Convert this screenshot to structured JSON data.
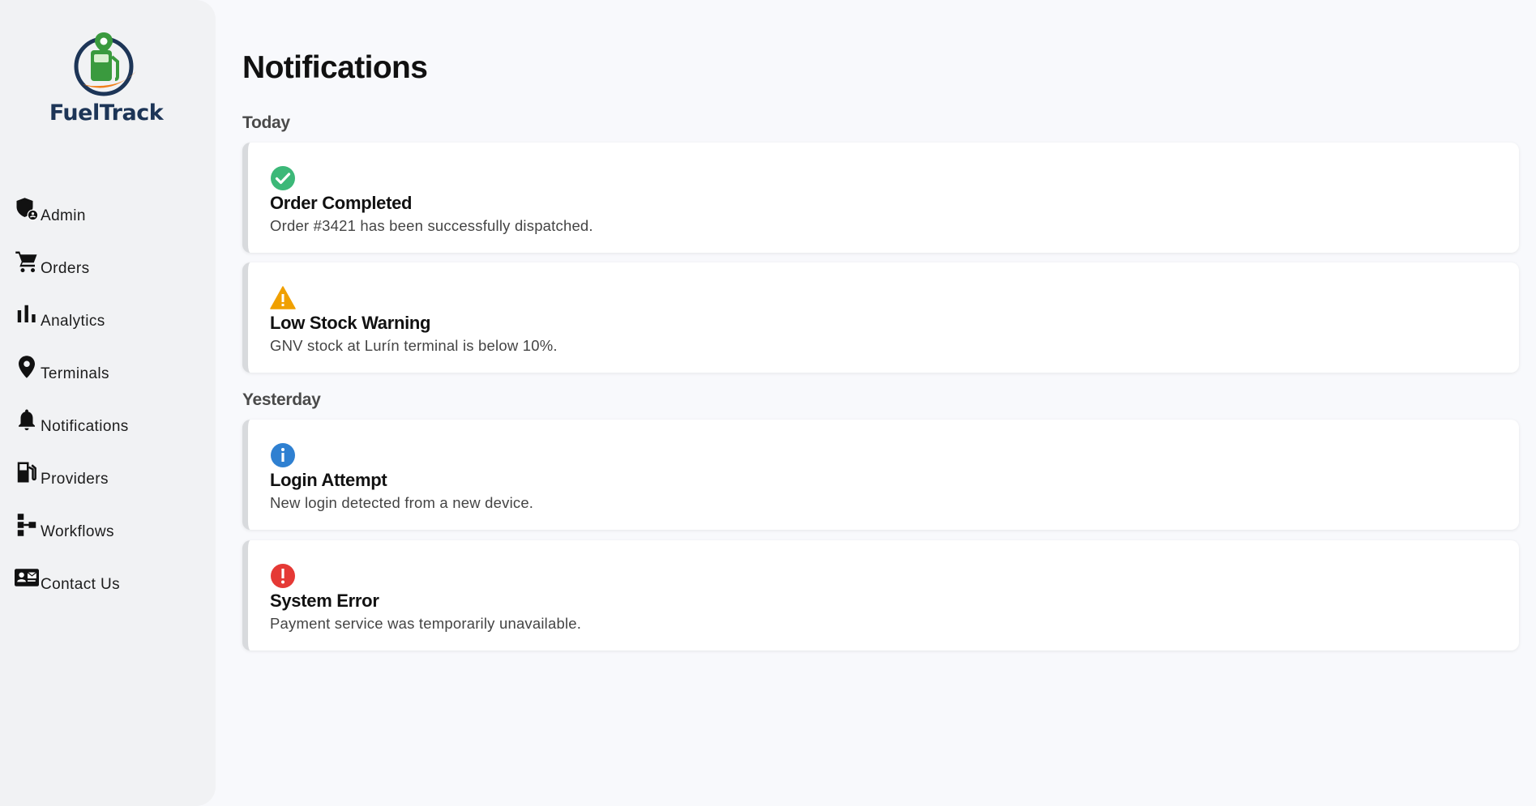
{
  "app": {
    "name": "FuelTrack"
  },
  "sidebar": {
    "items": [
      {
        "label": "Admin",
        "icon": "admin-shield-icon"
      },
      {
        "label": "Orders",
        "icon": "cart-icon"
      },
      {
        "label": "Analytics",
        "icon": "bar-chart-icon"
      },
      {
        "label": "Terminals",
        "icon": "map-pin-icon"
      },
      {
        "label": "Notifications",
        "icon": "bell-icon"
      },
      {
        "label": "Providers",
        "icon": "fuel-pump-icon"
      },
      {
        "label": "Workflows",
        "icon": "workflow-icon"
      },
      {
        "label": "Contact Us",
        "icon": "contact-card-icon"
      }
    ]
  },
  "main": {
    "title": "Notifications",
    "groups": [
      {
        "label": "Today",
        "notifications": [
          {
            "title": "Order Completed",
            "message": "Order #3421 has been successfully dispatched.",
            "icon": "check-circle-icon",
            "color": "#3cb878"
          },
          {
            "title": "Low Stock Warning",
            "message": "GNV stock at Lurín terminal is below 10%.",
            "icon": "warning-triangle-icon",
            "color": "#f0a000"
          }
        ]
      },
      {
        "label": "Yesterday",
        "notifications": [
          {
            "title": "Login Attempt",
            "message": "New login detected from a new device.",
            "icon": "info-circle-icon",
            "color": "#2f80d1"
          },
          {
            "title": "System Error",
            "message": "Payment service was temporarily unavailable.",
            "icon": "error-circle-icon",
            "color": "#e53935"
          }
        ]
      }
    ]
  }
}
